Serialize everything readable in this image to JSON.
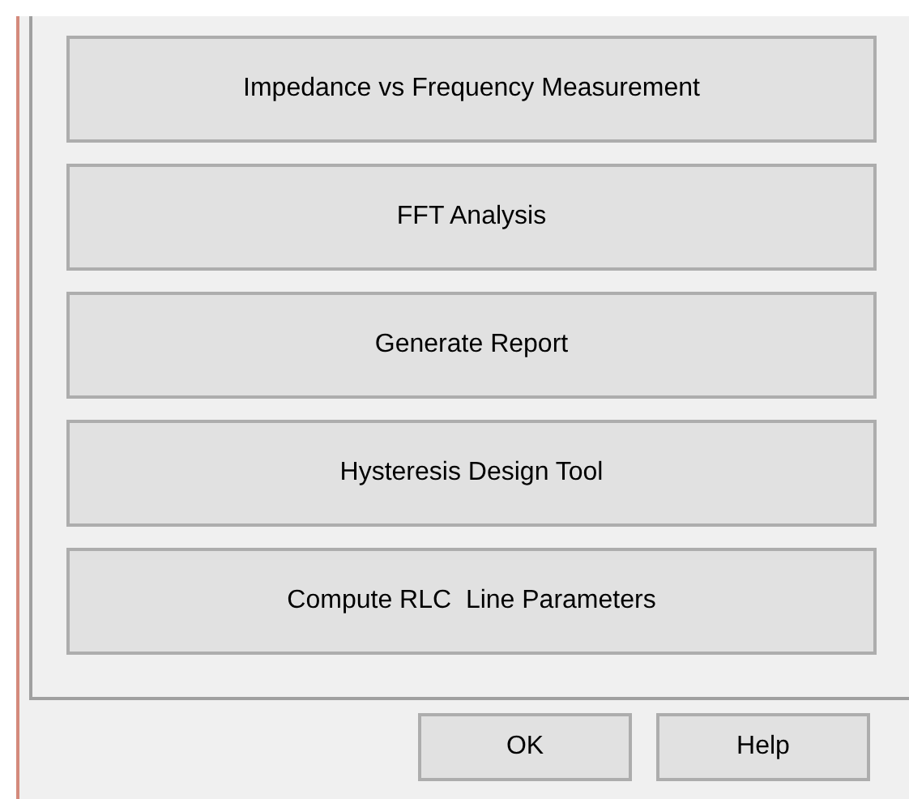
{
  "actions": [
    {
      "label": "Impedance vs Frequency Measurement"
    },
    {
      "label": "FFT Analysis"
    },
    {
      "label": "Generate Report"
    },
    {
      "label": "Hysteresis Design Tool"
    },
    {
      "label": "Compute RLC  Line Parameters"
    }
  ],
  "buttons": [
    "OK",
    "Help"
  ]
}
